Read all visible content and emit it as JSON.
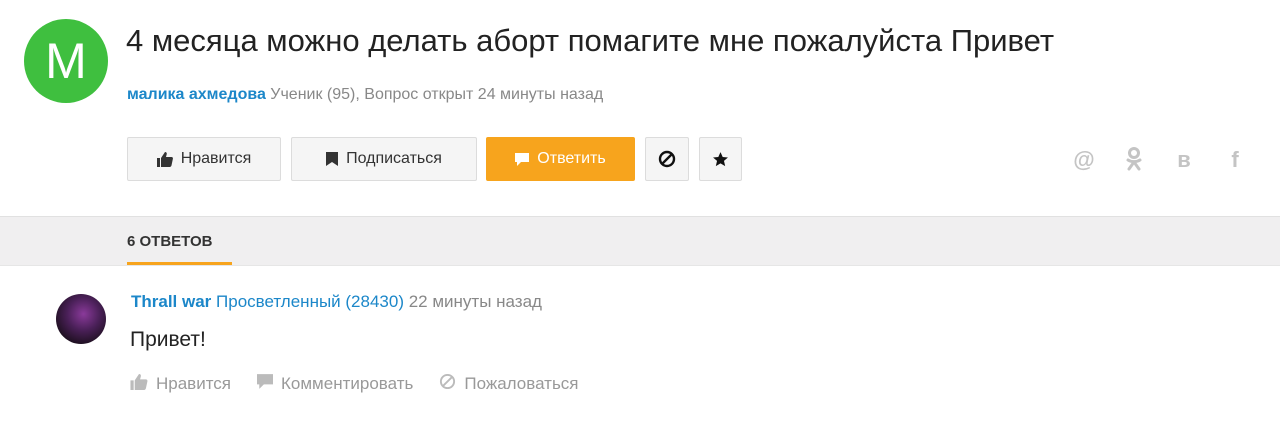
{
  "question": {
    "avatar_letter": "M",
    "title": "4 месяца можно делать аборт помагите мне пожалуйста Привет",
    "author": "малика ахмедова",
    "meta": " Ученик (95), Вопрос открыт 24 минуты назад"
  },
  "actions": {
    "like_label": "Нравится",
    "subscribe_label": "Подписаться",
    "answer_label": "Ответить",
    "block_icon": "block-icon",
    "star_icon": "star-icon"
  },
  "share": {
    "mail": "@",
    "ok": "ok",
    "vk": "в",
    "fb": "f"
  },
  "answers_tab": {
    "label": "6 ОТВЕТОВ"
  },
  "answer": {
    "author": "Thrall war",
    "rank": " Просветленный (28430)",
    "time": " 22 минуты назад",
    "text": "Привет!",
    "like_label": "Нравится",
    "comment_label": "Комментировать",
    "report_label": "Пожаловаться"
  },
  "colors": {
    "accent": "#f7a41d",
    "link": "#1c87c9",
    "avatar": "#3fbf3f"
  }
}
